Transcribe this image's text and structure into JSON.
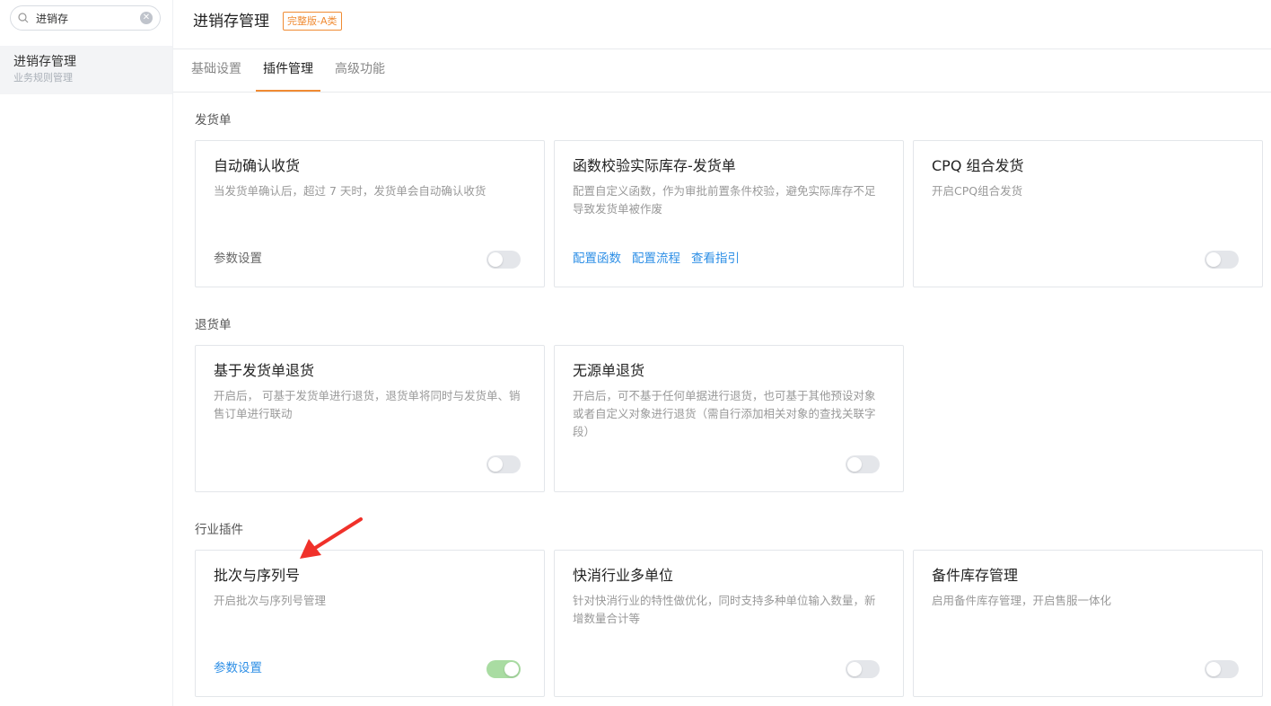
{
  "sidebar": {
    "search": {
      "value": "进销存",
      "placeholder": ""
    },
    "items": [
      {
        "label": "进销存管理",
        "sub": "业务规则管理"
      }
    ]
  },
  "header": {
    "title": "进销存管理",
    "badge": "完整版-A类"
  },
  "tabs": [
    {
      "label": "基础设置"
    },
    {
      "label": "插件管理"
    },
    {
      "label": "高级功能"
    }
  ],
  "sections": [
    {
      "title": "发货单",
      "cards": [
        {
          "title": "自动确认收货",
          "desc": "当发货单确认后，超过 7 天时，发货单会自动确认收货",
          "foot": "参数设置",
          "toggle": "off"
        },
        {
          "title": "函数校验实际库存-发货单",
          "desc": "配置自定义函数，作为审批前置条件校验，避免实际库存不足导致发货单被作废",
          "links": [
            "配置函数",
            "配置流程",
            "查看指引"
          ]
        },
        {
          "title": "CPQ 组合发货",
          "desc": "开启CPQ组合发货",
          "toggle": "off"
        }
      ]
    },
    {
      "title": "退货单",
      "cards": [
        {
          "title": "基于发货单退货",
          "desc": "开启后， 可基于发货单进行退货，退货单将同时与发货单、销售订单进行联动",
          "toggle": "off"
        },
        {
          "title": "无源单退货",
          "desc": "开启后，可不基于任何单据进行退货，也可基于其他预设对象或者自定义对象进行退货（需自行添加相关对象的查找关联字段）",
          "toggle": "off"
        }
      ]
    },
    {
      "title": "行业插件",
      "cards": [
        {
          "title": "批次与序列号",
          "desc": "开启批次与序列号管理",
          "foot": "参数设置",
          "toggle": "on"
        },
        {
          "title": "快消行业多单位",
          "desc": "针对快消行业的特性做优化，同时支持多种单位输入数量，新增数量合计等",
          "toggle": "off"
        },
        {
          "title": "备件库存管理",
          "desc": "启用备件库存管理，开启售服一体化",
          "toggle": "off"
        }
      ]
    }
  ],
  "colors": {
    "accent": "#f08b33",
    "link": "#2e8fe6",
    "toggle_on": "#a9dca2",
    "arrow": "#f0312a"
  }
}
